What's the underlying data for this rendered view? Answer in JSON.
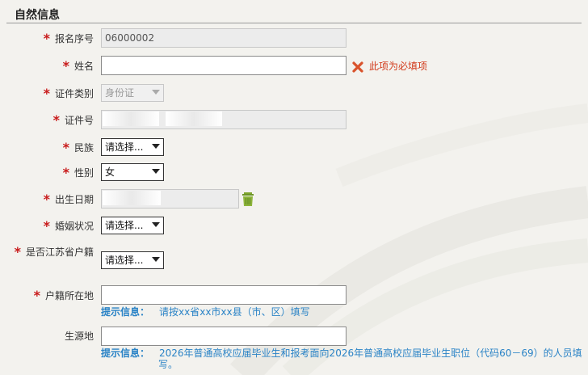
{
  "section": {
    "title": "自然信息"
  },
  "form": {
    "registration_no": {
      "label": "报名序号",
      "value": "06000002"
    },
    "name": {
      "label": "姓名",
      "value": "",
      "error": "此项为必填项"
    },
    "id_type": {
      "label": "证件类别",
      "value": "身份证"
    },
    "id_number": {
      "label": "证件号",
      "value": ""
    },
    "ethnicity": {
      "label": "民族",
      "value": "请选择..."
    },
    "gender": {
      "label": "性别",
      "value": "女"
    },
    "birth_date": {
      "label": "出生日期",
      "value": ""
    },
    "marital_status": {
      "label": "婚姻状况",
      "value": "请选择..."
    },
    "jiangsu_hukou": {
      "label": "是否江苏省户籍",
      "value": "请选择..."
    },
    "hukou_location": {
      "label": "户籍所在地",
      "value": "",
      "hint_label": "提示信息：",
      "hint": "请按xx省xx市xx县（市、区）填写"
    },
    "student_origin": {
      "label": "生源地",
      "value": "",
      "hint_label": "提示信息：",
      "hint_line1": "2026年普通高校应届毕业生和报考面向2026年普通高校应届毕业生职位（代码60－69）的人员填",
      "hint_line2": "写。"
    }
  },
  "required_mark": "*",
  "colors": {
    "required": "#c81a1a",
    "error": "#d23a1a",
    "hint": "#2a83c6"
  }
}
